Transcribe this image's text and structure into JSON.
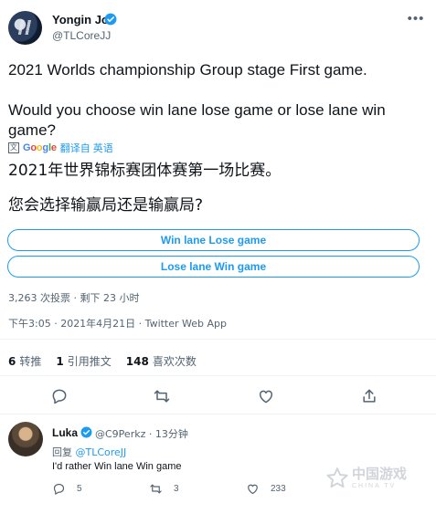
{
  "tweet": {
    "author_name": "Yongin Jo",
    "author_handle": "@TLCoreJJ",
    "text_line1": "2021 Worlds championship Group stage First game.",
    "text_line2": "Would you choose win lane lose game or lose lane win game?",
    "translate": {
      "provider": "Google",
      "label": "翻译自 英语"
    },
    "translated_line1": "2021年世界锦标赛团体赛第一场比赛。",
    "translated_line2": "您会选择输赢局还是输赢局?",
    "poll": {
      "options": [
        "Win lane Lose game",
        "Lose lane Win game"
      ],
      "meta": "3,263 次投票 · 剩下 23 小时"
    },
    "timestamp": "下午3:05 · 2021年4月21日 · Twitter Web App",
    "stats": [
      {
        "count": "6",
        "label": "转推"
      },
      {
        "count": "1",
        "label": "引用推文"
      },
      {
        "count": "148",
        "label": "喜欢次数"
      }
    ]
  },
  "reply": {
    "author_name": "Luka",
    "handle_time": "@C9Perkz · 13分钟",
    "reply_to_prefix": "回复",
    "reply_to_mention": "@TLCoreJJ",
    "text": "I'd rather Win lane Win game",
    "reply_count": "5",
    "retweet_count": "3",
    "like_count": "233"
  },
  "watermark": {
    "cn": "中国游戏",
    "en": "CHINA TV"
  },
  "colors": {
    "accent": "#1d9bf0",
    "text": "#0f1419",
    "secondary": "#536471"
  },
  "icons": [
    "more-icon",
    "verified-icon",
    "translate-icon",
    "reply-icon",
    "retweet-icon",
    "like-icon",
    "share-icon"
  ]
}
